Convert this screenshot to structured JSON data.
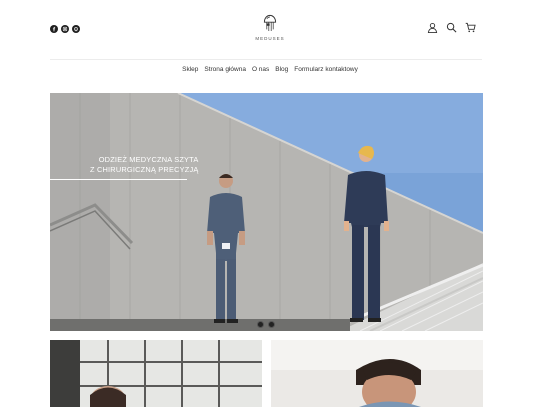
{
  "brand": {
    "name": "MEDUSES"
  },
  "social": [
    {
      "icon": "facebook-icon"
    },
    {
      "icon": "instagram-icon"
    },
    {
      "icon": "pinterest-icon"
    }
  ],
  "header_icons": [
    "user-icon",
    "search-icon",
    "cart-icon"
  ],
  "nav": [
    "Sklep",
    "Strona główna",
    "O nas",
    "Blog",
    "Formularz kontaktowy"
  ],
  "hero": {
    "caption_line1": "ODZIEŻ MEDYCZNA SZYTA",
    "caption_line2": "Z CHIRURGICZNĄ PRECYZJĄ",
    "slide_count": 2,
    "active_slide": 1
  },
  "colors": {
    "sky": "#7aa3d8",
    "wall": "#b4b3b0",
    "scrubs": "#4e5f78",
    "navy_scrubs": "#2e3b57",
    "text": "#333333"
  }
}
